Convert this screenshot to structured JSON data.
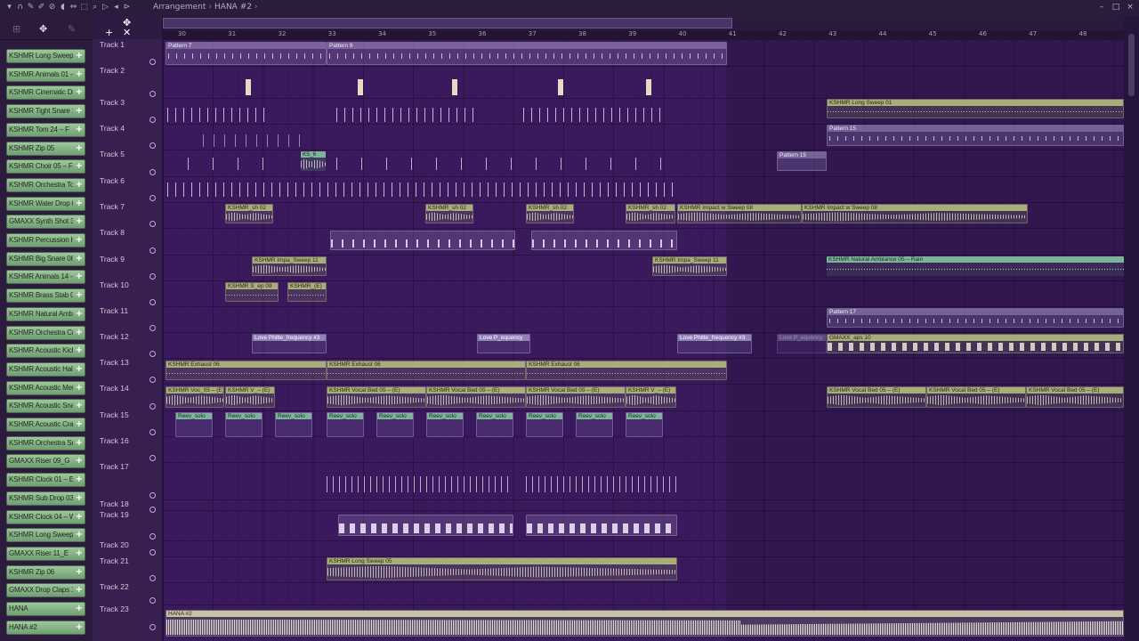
{
  "breadcrumb": {
    "section": "Arrangement",
    "separator": "›",
    "project": "HANA #2",
    "arrow": "›"
  },
  "toolbar_icons": [
    "snap-icon",
    "magnet-icon",
    "pencil-icon",
    "paint-icon",
    "delete-icon",
    "mute-icon",
    "slice-icon",
    "select-icon",
    "zoom-icon",
    "playback-icon",
    "speaker-icon",
    "slip-icon"
  ],
  "window_controls": {
    "minimize": "–",
    "maximize": "□",
    "close": "×"
  },
  "sidebar_tools": {
    "left": "⊞",
    "center": "✥",
    "right": "✎"
  },
  "channels": [
    "KSHMR Long Sweep 05",
    "KSHMR Animals 01 –",
    "KSHMR Cinematic Dru",
    "KSHMR Tight Snare 1",
    "KSHMR Tom 24 – F",
    "KSHMR Zip 05",
    "KSHMR Choir 05 – F M",
    "KSHMR Orchestra To",
    "KSHMR Water Drop 02",
    "GMAXX Synth Shot 30",
    "KSHMR Percussion Hi",
    "KSHMR Big Snare 06",
    "KSHMR Animals 14 –",
    "KSHMR Brass Stab 03",
    "KSHMR Natural Ambi",
    "KSHMR Orchestra Cra",
    "KSHMR Acoustic Kick",
    "KSHMR Acoustic Hall",
    "KSHMR Acoustic Meta",
    "KSHMR Acoustic Snar",
    "KSHMR Acoustic Cras",
    "KSHMR Orchestra Sna",
    "GMAXX Riser 09_G",
    "KSHMR Clock 01 – Ex",
    "KSHMR Sub Drop 03 –",
    "KSHMR Clock 04 – W",
    "KSHMR Long Sweep 12",
    "GMAXX Riser 11_E",
    "KSHMR Zip 06",
    "GMAXX Drop Claps 10",
    "HANA",
    "HANA #2"
  ],
  "channel_add_label": "+",
  "tracks": [
    "Track 1",
    "Track 2",
    "Track 3",
    "Track 4",
    "Track 5",
    "Track 6",
    "Track 7",
    "Track 8",
    "Track 9",
    "Track 10",
    "Track 11",
    "Track 12",
    "Track 13",
    "Track 14",
    "Track 15",
    "Track 16",
    "Track 17",
    "Track 18",
    "Track 19",
    "Track 20",
    "Track 21",
    "Track 22",
    "Track 23"
  ],
  "ruler_bars": [
    "30",
    "31",
    "32",
    "33",
    "34",
    "35",
    "36",
    "37",
    "38",
    "39",
    "40",
    "41",
    "42",
    "43",
    "44",
    "45",
    "46",
    "47",
    "48"
  ],
  "clips": {
    "pattern7": "Pattern 7",
    "pattern9": "Pattern 9",
    "sweep01": "KSHMR Long Sweep 01",
    "pattern15a": "Pattern 15",
    "pattern15b": "Pattern 15",
    "k56": "K5_6",
    "ksh02a": "KSHMR_sh 02",
    "ksh02b": "KSHMR_sh 02",
    "ksh02c": "KSHMR_sh 02",
    "ksh02d": "KSHMR_sh 02",
    "impact1": "KSHMR Impact w Sweep 08",
    "impact2": "KSHMR Impact w Sweep 08",
    "impa1": "KSHMR Impa_Sweep 11",
    "impa2": "KSHMR Impa_Sweep 11",
    "ambiance": "KSHMR Natural Ambiance 05 – Rain",
    "kshs09": "KSHMR S_ep 09",
    "kshmr_e": "KSHMR_(E)",
    "pattern17": "Pattern 17",
    "love1": "Love Philte_frequency #3",
    "love2": "Love P_equency",
    "love3": "Love Philte_frequency #3",
    "love4": "Love P_equency",
    "gmaxx": "GMAXX_aps 10",
    "exhaust1": "KSHMR Exhaust 06",
    "exhaust2": "KSHMR Exhaust 06",
    "exhaust3": "KSHMR Exhaust 06",
    "voc1": "KSHMR Voc_05 – (E)",
    "voc2": "KSHMR V_– (E)",
    "vbed1": "KSHMR Vocal Bed 05 – (E)",
    "vbed2": "KSHMR Vocal Bed 05 – (E)",
    "vbed3": "KSHMR Vocal Bed 05 – (E)",
    "voc3": "KSHMR V_– (E)",
    "vbed4": "KSHMR Vocal Bed 05 – (E)",
    "vbed5": "KSHMR Vocal Bed 05 – (E)",
    "vbed6": "KSHMR Vocal Bed 05 – (E)",
    "revsolo": "Reev_solo",
    "sweep05": "KSHMR Long Sweep 05",
    "hana2": "HANA #2"
  },
  "colors": {
    "background": "#3a1a5c",
    "channel_green": "#8fbf8c",
    "clip_header": "#a8ad7a",
    "accent": "#c7a3e6"
  }
}
